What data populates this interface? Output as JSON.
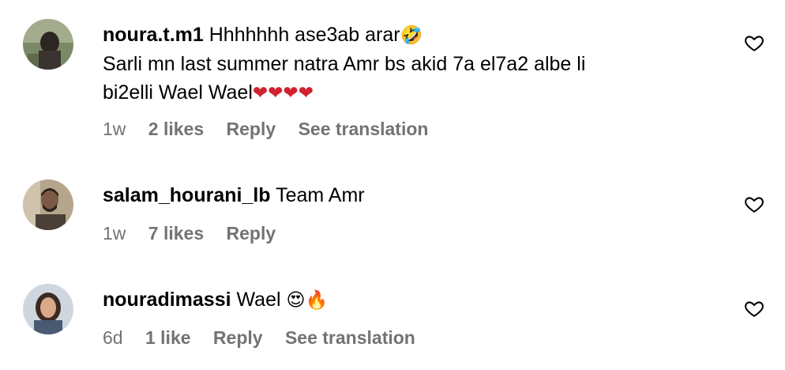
{
  "comments": [
    {
      "username": "noura.t.m1",
      "text_line1": "Hhhhhhh ase3ab arar",
      "emoji1": "🤣",
      "text_line2": "Sarli mn last summer natra Amr bs akid 7a el7a2 albe li",
      "text_line3": "bi2elli Wael Wael",
      "emoji3": "❤❤❤❤",
      "time": "1w",
      "likes": "2 likes",
      "reply": "Reply",
      "translation": "See translation"
    },
    {
      "username": "salam_hourani_lb",
      "text_line1": "Team Amr",
      "time": "1w",
      "likes": "7 likes",
      "reply": "Reply"
    },
    {
      "username": "nouradimassi",
      "text_line1": "Wael",
      "emoji1": "😍🔥",
      "time": "6d",
      "likes": "1 like",
      "reply": "Reply",
      "translation": "See translation"
    }
  ],
  "icons": {
    "like": "heart-outline-icon"
  },
  "colors": {
    "meta": "#737373",
    "heart_red": "#d0232f"
  }
}
